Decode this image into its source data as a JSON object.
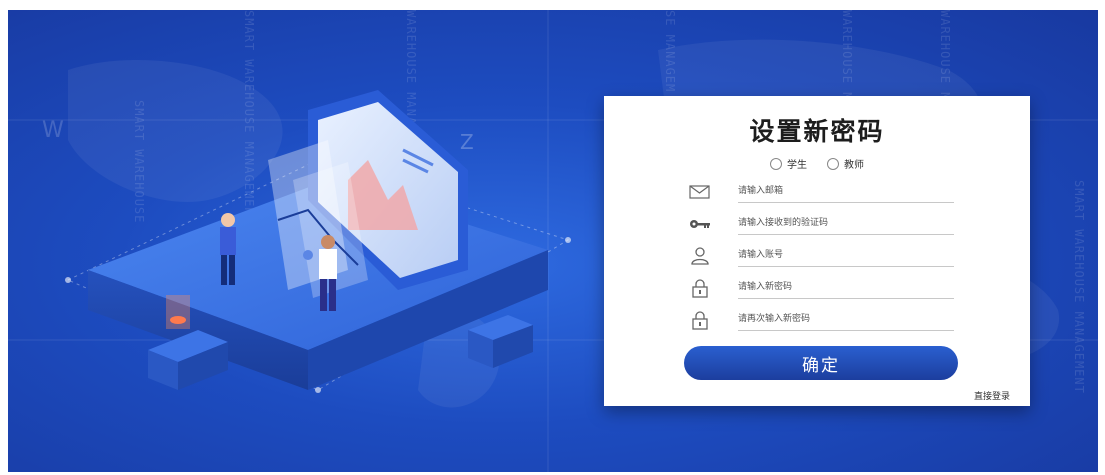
{
  "panel": {
    "title": "设置新密码",
    "roles": [
      {
        "label": "学生",
        "selected": false
      },
      {
        "label": "教师",
        "selected": false
      }
    ],
    "fields": [
      {
        "icon": "mail-icon",
        "placeholder": "请输入邮箱"
      },
      {
        "icon": "key-icon",
        "placeholder": "请输入接收到的验证码"
      },
      {
        "icon": "user-icon",
        "placeholder": "请输入账号"
      },
      {
        "icon": "lock-icon",
        "placeholder": "请输入新密码"
      },
      {
        "icon": "lock-icon",
        "placeholder": "请再次输入新密码"
      }
    ],
    "submit_label": "确定",
    "login_link": "直接登录"
  },
  "background": {
    "watermarks": [
      "SMART WAREHOUSE",
      "SMART WAREHOUSE MANAGEMENT",
      "WAREHOUSE MANAGEMENT",
      "SE MANAGEM",
      "WAREHOUSE MANA",
      "WAREHOUSE M",
      "SMART WAREHOUSE MANAGEMENT"
    ],
    "letters": [
      "W",
      "Z"
    ],
    "colors": {
      "primary": "#1d4cc0",
      "button": "#2a5fd0"
    }
  }
}
